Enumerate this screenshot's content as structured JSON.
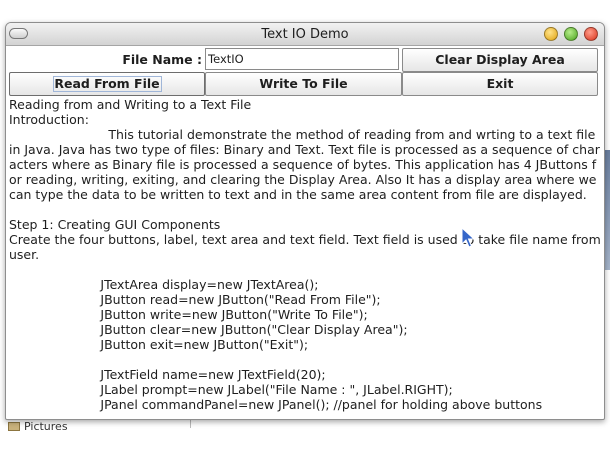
{
  "window": {
    "title": "Text IO Demo"
  },
  "form": {
    "file_label": "File Name :",
    "file_value": "TextIO"
  },
  "buttons": {
    "clear": "Clear Display Area",
    "read": "Read From File",
    "write": "Write To File",
    "exit": "Exit"
  },
  "display": {
    "text": "Reading from and Writing to a Text File\nIntroduction:\n                         This tutorial demonstrate the method of reading from and wrting to a text file in Java. Java has two type of files: Binary and Text. Text file is processed as a sequence of characters where as Binary file is processed a sequence of bytes. This application has 4 JButtons for reading, writing, exiting, and clearing the Display Area. Also It has a display area where we can type the data to be written to text and in the same area content from file are displayed.\n\nStep 1: Creating GUI Components\nCreate the four buttons, label, text area and text field. Text field is used to take file name from user.\n\n                       JTextArea display=new JTextArea();\n                       JButton read=new JButton(\"Read From File\");\n                       JButton write=new JButton(\"Write To File\");\n                       JButton clear=new JButton(\"Clear Display Area\");\n                       JButton exit=new JButton(\"Exit\");\n\n                       JTextField name=new JTextField(20);\n                       JLabel prompt=new JLabel(\"File Name : \", JLabel.RIGHT);\n                       JPanel commandPanel=new JPanel(); //panel for holding above buttons"
  },
  "background": {
    "item_label": "Pictures"
  },
  "colors": {
    "titlebar": "#dcdcdc",
    "close": "#d9331b",
    "maximize": "#4ca41e",
    "minimize": "#e0a311"
  }
}
